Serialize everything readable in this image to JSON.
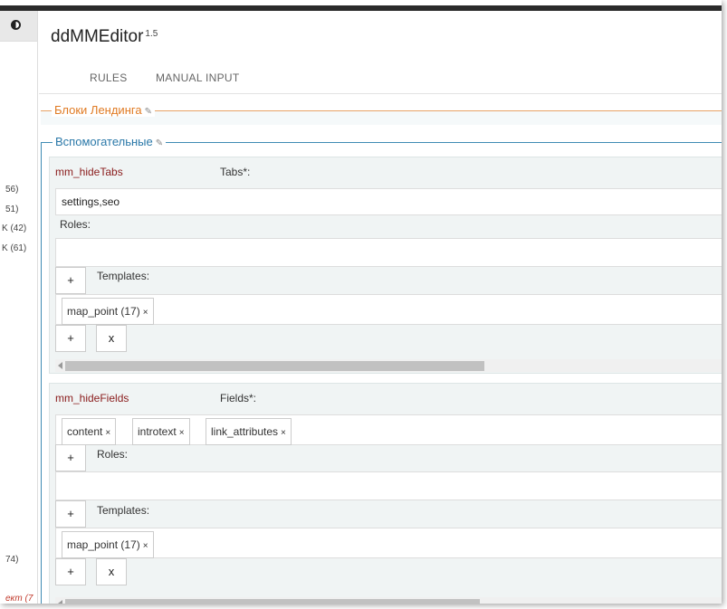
{
  "app": {
    "title": "ddMMEditor",
    "version": "1.5"
  },
  "tabs": [
    {
      "label": "RULES"
    },
    {
      "label": "MANUAL INPUT"
    }
  ],
  "tree": {
    "items": [
      {
        "label": "56)"
      },
      {
        "label": "51)"
      },
      {
        "label": "Κ (42)"
      },
      {
        "label": "Κ (61)"
      },
      {
        "label": "74)"
      },
      {
        "label": "ект (7"
      }
    ]
  },
  "groups": [
    {
      "title": "Блоки Лендинга"
    },
    {
      "title": "Вспомогательные"
    }
  ],
  "rules": [
    {
      "name": "mm_hideTabs",
      "label": "Tabs*:",
      "value": "settings,seo",
      "roles_label": "Roles:",
      "templates_label": "Templates:",
      "templates": [
        {
          "label": "map_point (17)"
        }
      ],
      "add_label": "+",
      "remove_label": "x"
    },
    {
      "name": "mm_hideFields",
      "label": "Fields*:",
      "fields": [
        {
          "label": "content"
        },
        {
          "label": "introtext"
        },
        {
          "label": "link_attributes"
        }
      ],
      "roles_label": "Roles:",
      "templates_label": "Templates:",
      "templates": [
        {
          "label": "map_point (17)"
        }
      ],
      "add_label": "+",
      "remove_label": "x"
    }
  ],
  "icons": {
    "toggle": "half-circle-icon",
    "edit": "pencil-icon",
    "chip_remove": "times-icon"
  },
  "colors": {
    "group_orange": "#e07b24",
    "group_blue": "#2a78a8",
    "rule_name": "#8a1c1c"
  }
}
